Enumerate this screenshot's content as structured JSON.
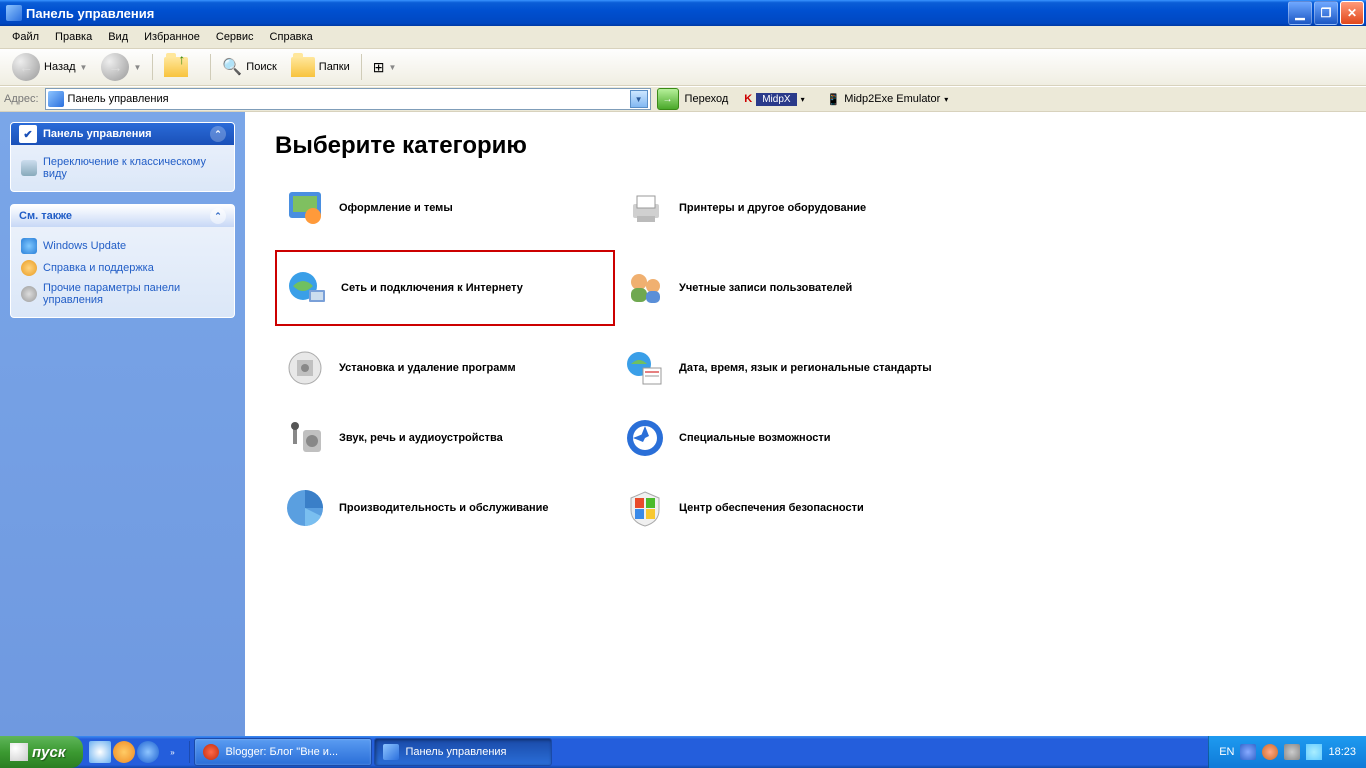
{
  "title": "Панель управления",
  "menu": [
    "Файл",
    "Правка",
    "Вид",
    "Избранное",
    "Сервис",
    "Справка"
  ],
  "toolbar": {
    "back": "Назад",
    "search": "Поиск",
    "folders": "Папки"
  },
  "addressbar": {
    "label": "Адрес:",
    "value": "Панель управления",
    "go": "Переход",
    "ext1": "MidpX",
    "ext2": "Midp2Exe Emulator"
  },
  "sidebar": {
    "panel1": {
      "title": "Панель управления",
      "link": "Переключение к классическому виду"
    },
    "panel2": {
      "title": "См. также",
      "links": [
        "Windows Update",
        "Справка и поддержка",
        "Прочие параметры панели управления"
      ]
    }
  },
  "content": {
    "heading": "Выберите категорию",
    "cats": [
      {
        "label": "Оформление и темы"
      },
      {
        "label": "Принтеры и другое оборудование"
      },
      {
        "label": "Сеть и подключения к Интернету",
        "highlight": true
      },
      {
        "label": "Учетные записи пользователей"
      },
      {
        "label": "Установка и удаление программ"
      },
      {
        "label": "Дата, время, язык и региональные стандарты"
      },
      {
        "label": "Звук, речь и аудиоустройства"
      },
      {
        "label": "Специальные возможности"
      },
      {
        "label": "Производительность и обслуживание"
      },
      {
        "label": "Центр обеспечения безопасности"
      }
    ]
  },
  "taskbar": {
    "start": "пуск",
    "buttons": [
      "Blogger: Блог \"Вне и...",
      "Панель управления"
    ],
    "lang": "EN",
    "clock": "18:23"
  }
}
